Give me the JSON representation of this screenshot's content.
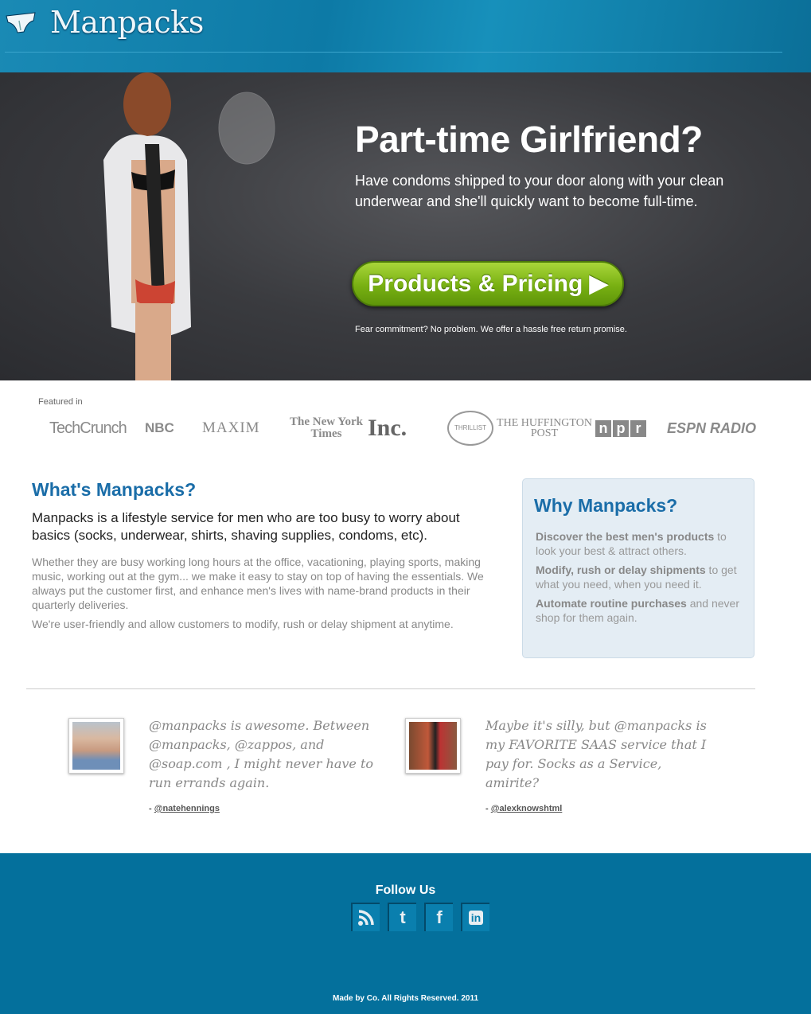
{
  "header": {
    "brand": "Manpacks"
  },
  "hero": {
    "title": "Part-time Girlfriend?",
    "subtitle": "Have condoms shipped to your door along with your clean underwear and she'll quickly want to become full-time.",
    "cta_label": "Products & Pricing ▶",
    "note": "Fear commitment? No problem. We offer a hassle free return promise."
  },
  "featured": {
    "label": "Featured in",
    "logos": [
      "TechCrunch",
      "NBC",
      "MAXIM",
      "The New York Times",
      "Inc.",
      "THRILLIST",
      "THE HUFFINGTON POST",
      "npr",
      "ESPN RADIO"
    ]
  },
  "what": {
    "title": "What's Manpacks?",
    "lead": "Manpacks is a lifestyle service for men who are too busy to worry about basics (socks, underwear, shirts, shaving supplies, condoms, etc).",
    "p1": "Whether they are busy working long hours at the office, vacationing, playing sports, making music, working out at the gym... we make it easy to stay on top of having the essentials. We always put the customer first, and enhance men's lives with name-brand products in their quarterly deliveries.",
    "p2": "We're user-friendly and allow customers to modify, rush or delay shipment at anytime."
  },
  "why": {
    "title": "Why Manpacks?",
    "items": [
      {
        "bold": "Discover the best men's products",
        "rest": " to look your best & attract others."
      },
      {
        "bold": "Modify, rush or delay shipments",
        "rest": " to get what you need, when you need it."
      },
      {
        "bold": "Automate routine purchases",
        "rest": " and never shop for them again."
      }
    ]
  },
  "testimonials": [
    {
      "quote": "@manpacks is awesome. Between @manpacks, @zappos, and @soap.com , I might never have to run errands again.",
      "prefix": "- ",
      "handle": "@natehennings"
    },
    {
      "quote": "Maybe it's silly, but @manpacks is my FAVORITE SAAS service that I pay for. Socks as a Service, amirite?",
      "prefix": "- ",
      "handle": "@alexknowshtml"
    }
  ],
  "footer": {
    "follow": "Follow Us",
    "social": [
      "rss-icon",
      "twitter-icon",
      "facebook-icon",
      "linkedin-icon"
    ],
    "copyright": "Made by Co. All Rights Reserved. 2011"
  },
  "colors": {
    "brand_blue": "#04709c",
    "heading_blue": "#1a6da8",
    "cta_green": "#78b012"
  }
}
